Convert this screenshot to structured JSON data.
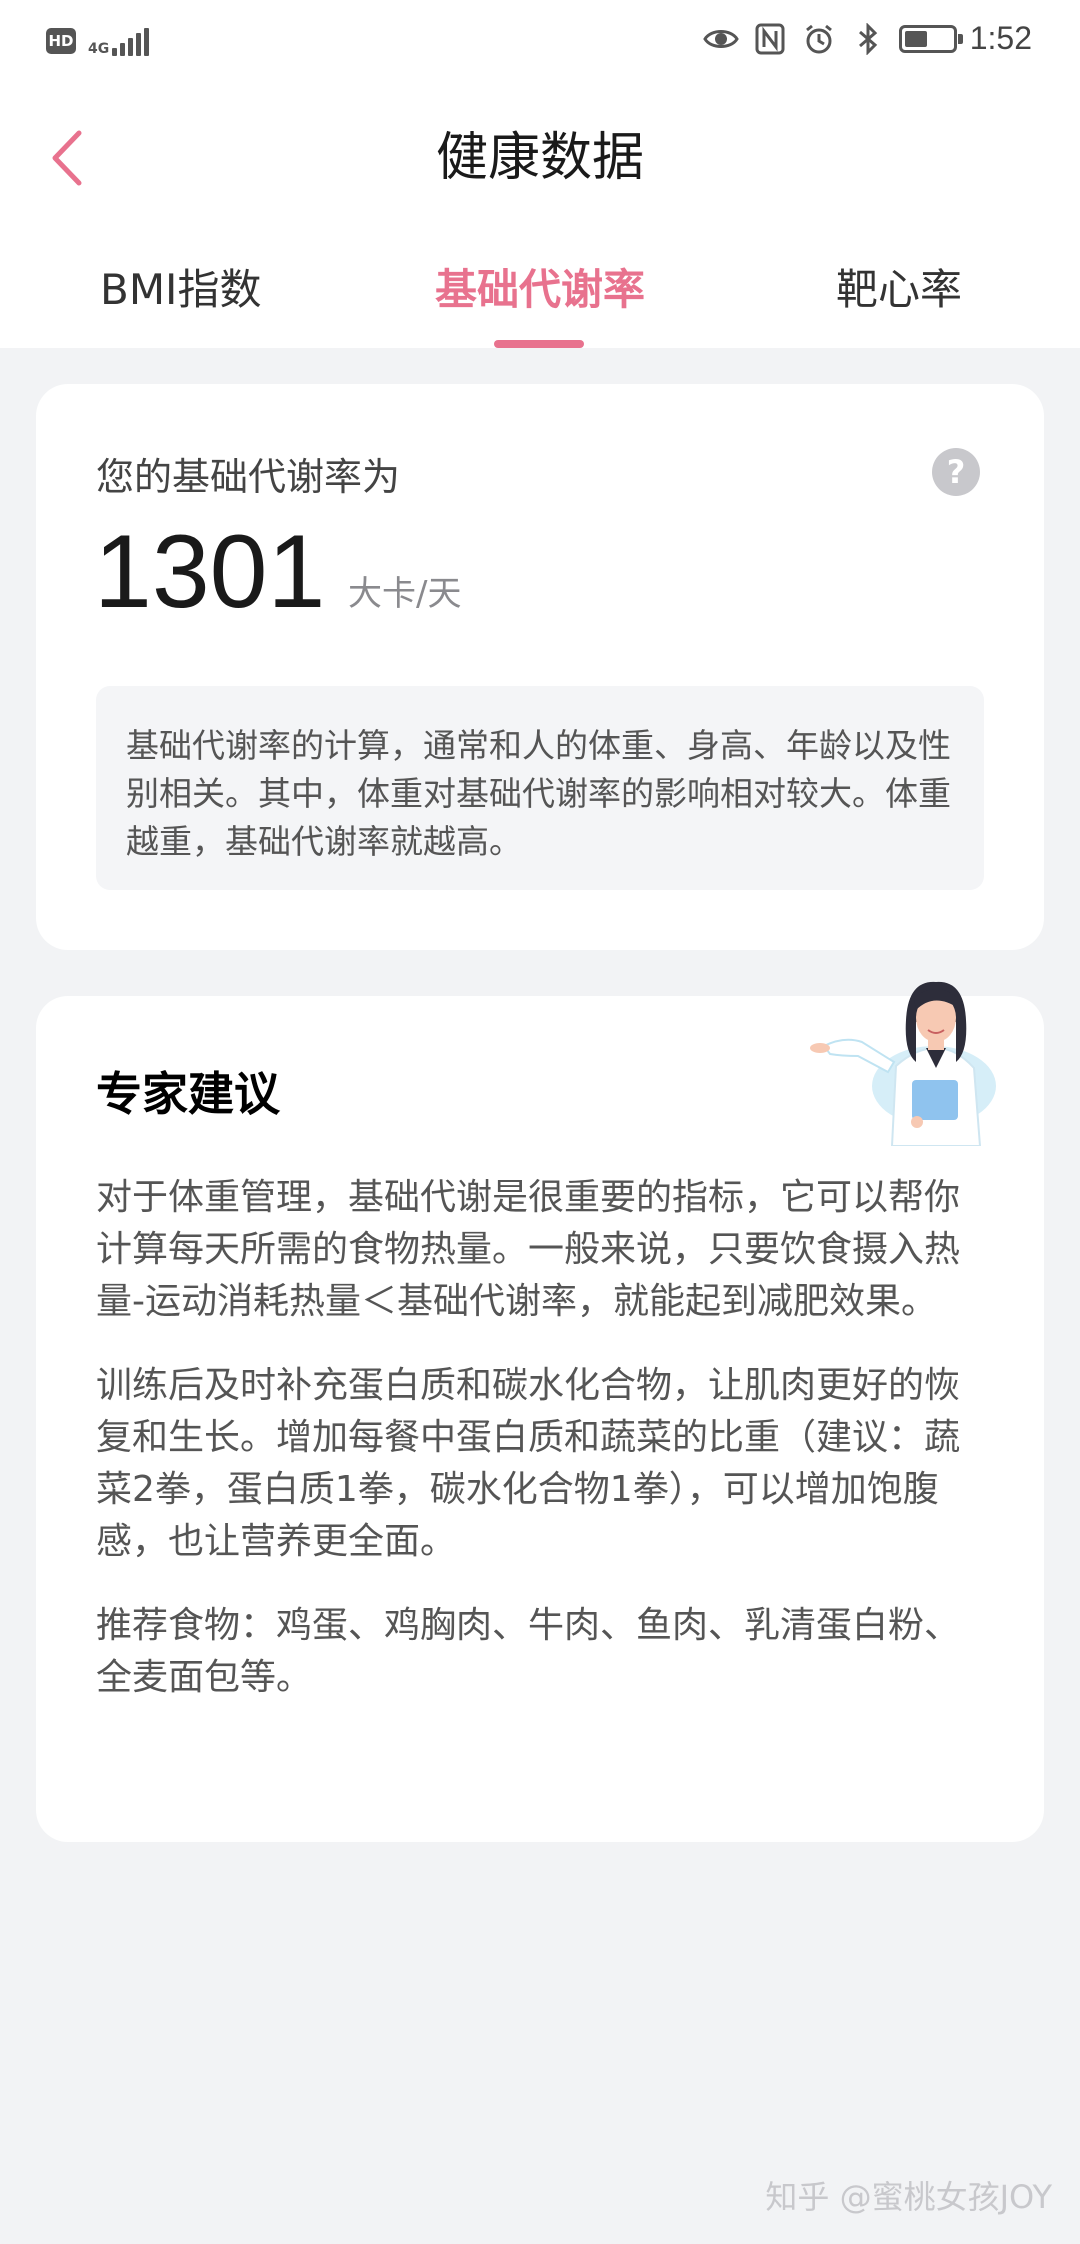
{
  "status_bar": {
    "hd": "HD",
    "network": "4G",
    "time": "1:52",
    "battery_level": 0.55,
    "icons": [
      "eye-icon",
      "nfc-icon",
      "alarm-icon",
      "bluetooth-icon",
      "battery-icon"
    ]
  },
  "header": {
    "title": "健康数据",
    "back_icon": "chevron-left-icon"
  },
  "tabs": [
    {
      "label": "BMI指数",
      "active": false
    },
    {
      "label": "基础代谢率",
      "active": true
    },
    {
      "label": "靶心率",
      "active": false
    }
  ],
  "bmr_card": {
    "label": "您的基础代谢率为",
    "value": "1301",
    "unit": "大卡/天",
    "help_icon_text": "?",
    "info": "基础代谢率的计算，通常和人的体重、身高、年龄以及性别相关。其中，体重对基础代谢率的影响相对较大。体重越重，基础代谢率就越高。"
  },
  "advice_card": {
    "title": "专家建议",
    "paragraphs": [
      "对于体重管理，基础代谢是很重要的指标，它可以帮你计算每天所需的食物热量。一般来说，只要饮食摄入热量-运动消耗热量＜基础代谢率，就能起到减肥效果。",
      "训练后及时补充蛋白质和碳水化合物，让肌肉更好的恢复和生长。增加每餐中蛋白质和蔬菜的比重（建议：蔬菜2拳，蛋白质1拳，碳水化合物1拳），可以增加饱腹感，也让营养更全面。",
      "推荐食物：鸡蛋、鸡胸肉、牛肉、鱼肉、乳清蛋白粉、全麦面包等。"
    ]
  },
  "watermark": "知乎 @蜜桃女孩JOY",
  "colors": {
    "accent": "#e8728e",
    "background": "#f2f3f5",
    "card": "#ffffff"
  }
}
